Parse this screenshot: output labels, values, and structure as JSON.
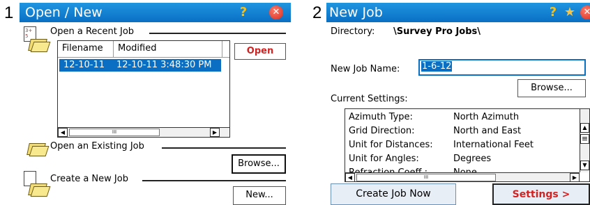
{
  "steps": {
    "first": "1",
    "second": "2"
  },
  "open_new": {
    "title": "Open / New",
    "recent_section": "Open a Recent Job",
    "columns": [
      "Filename",
      "Modified"
    ],
    "rows": [
      {
        "filename": "12-10-11",
        "modified": "12-10-11 3:48:30 PM"
      }
    ],
    "open_button": "Open",
    "existing_section": "Open an Existing Job",
    "browse_button": "Browse...",
    "new_section": "Create a New Job",
    "new_button": "New...",
    "recent_icon_text": "3+ 5",
    "scroll_thumb": "III"
  },
  "new_job": {
    "title": "New Job",
    "directory_label": "Directory:",
    "directory_value": "\\Survey Pro Jobs\\",
    "name_label": "New Job Name:",
    "name_value": "1-6-12",
    "browse_button": "Browse...",
    "current_settings_label": "Current Settings:",
    "settings": [
      {
        "key": "Azimuth Type:",
        "value": "North Azimuth"
      },
      {
        "key": "Grid Direction:",
        "value": "North and East"
      },
      {
        "key": "Unit for Distances:",
        "value": "International Feet"
      },
      {
        "key": "Unit for Angles:",
        "value": "Degrees"
      },
      {
        "key": "Refraction Coeff.:",
        "value": "None"
      }
    ],
    "create_button": "Create Job Now",
    "settings_button": "Settings >",
    "scroll_thumb": "III"
  },
  "icons": {
    "help": "?",
    "star": "★",
    "close": "✕",
    "arrow_left": "◀",
    "arrow_right": "▶",
    "arrow_up": "▲",
    "arrow_down": "▼",
    "scroll_grip": "≡"
  },
  "colors": {
    "titlebar": "#0a6fc3",
    "selection": "#0a6fc3",
    "accent_red": "#d32222"
  }
}
